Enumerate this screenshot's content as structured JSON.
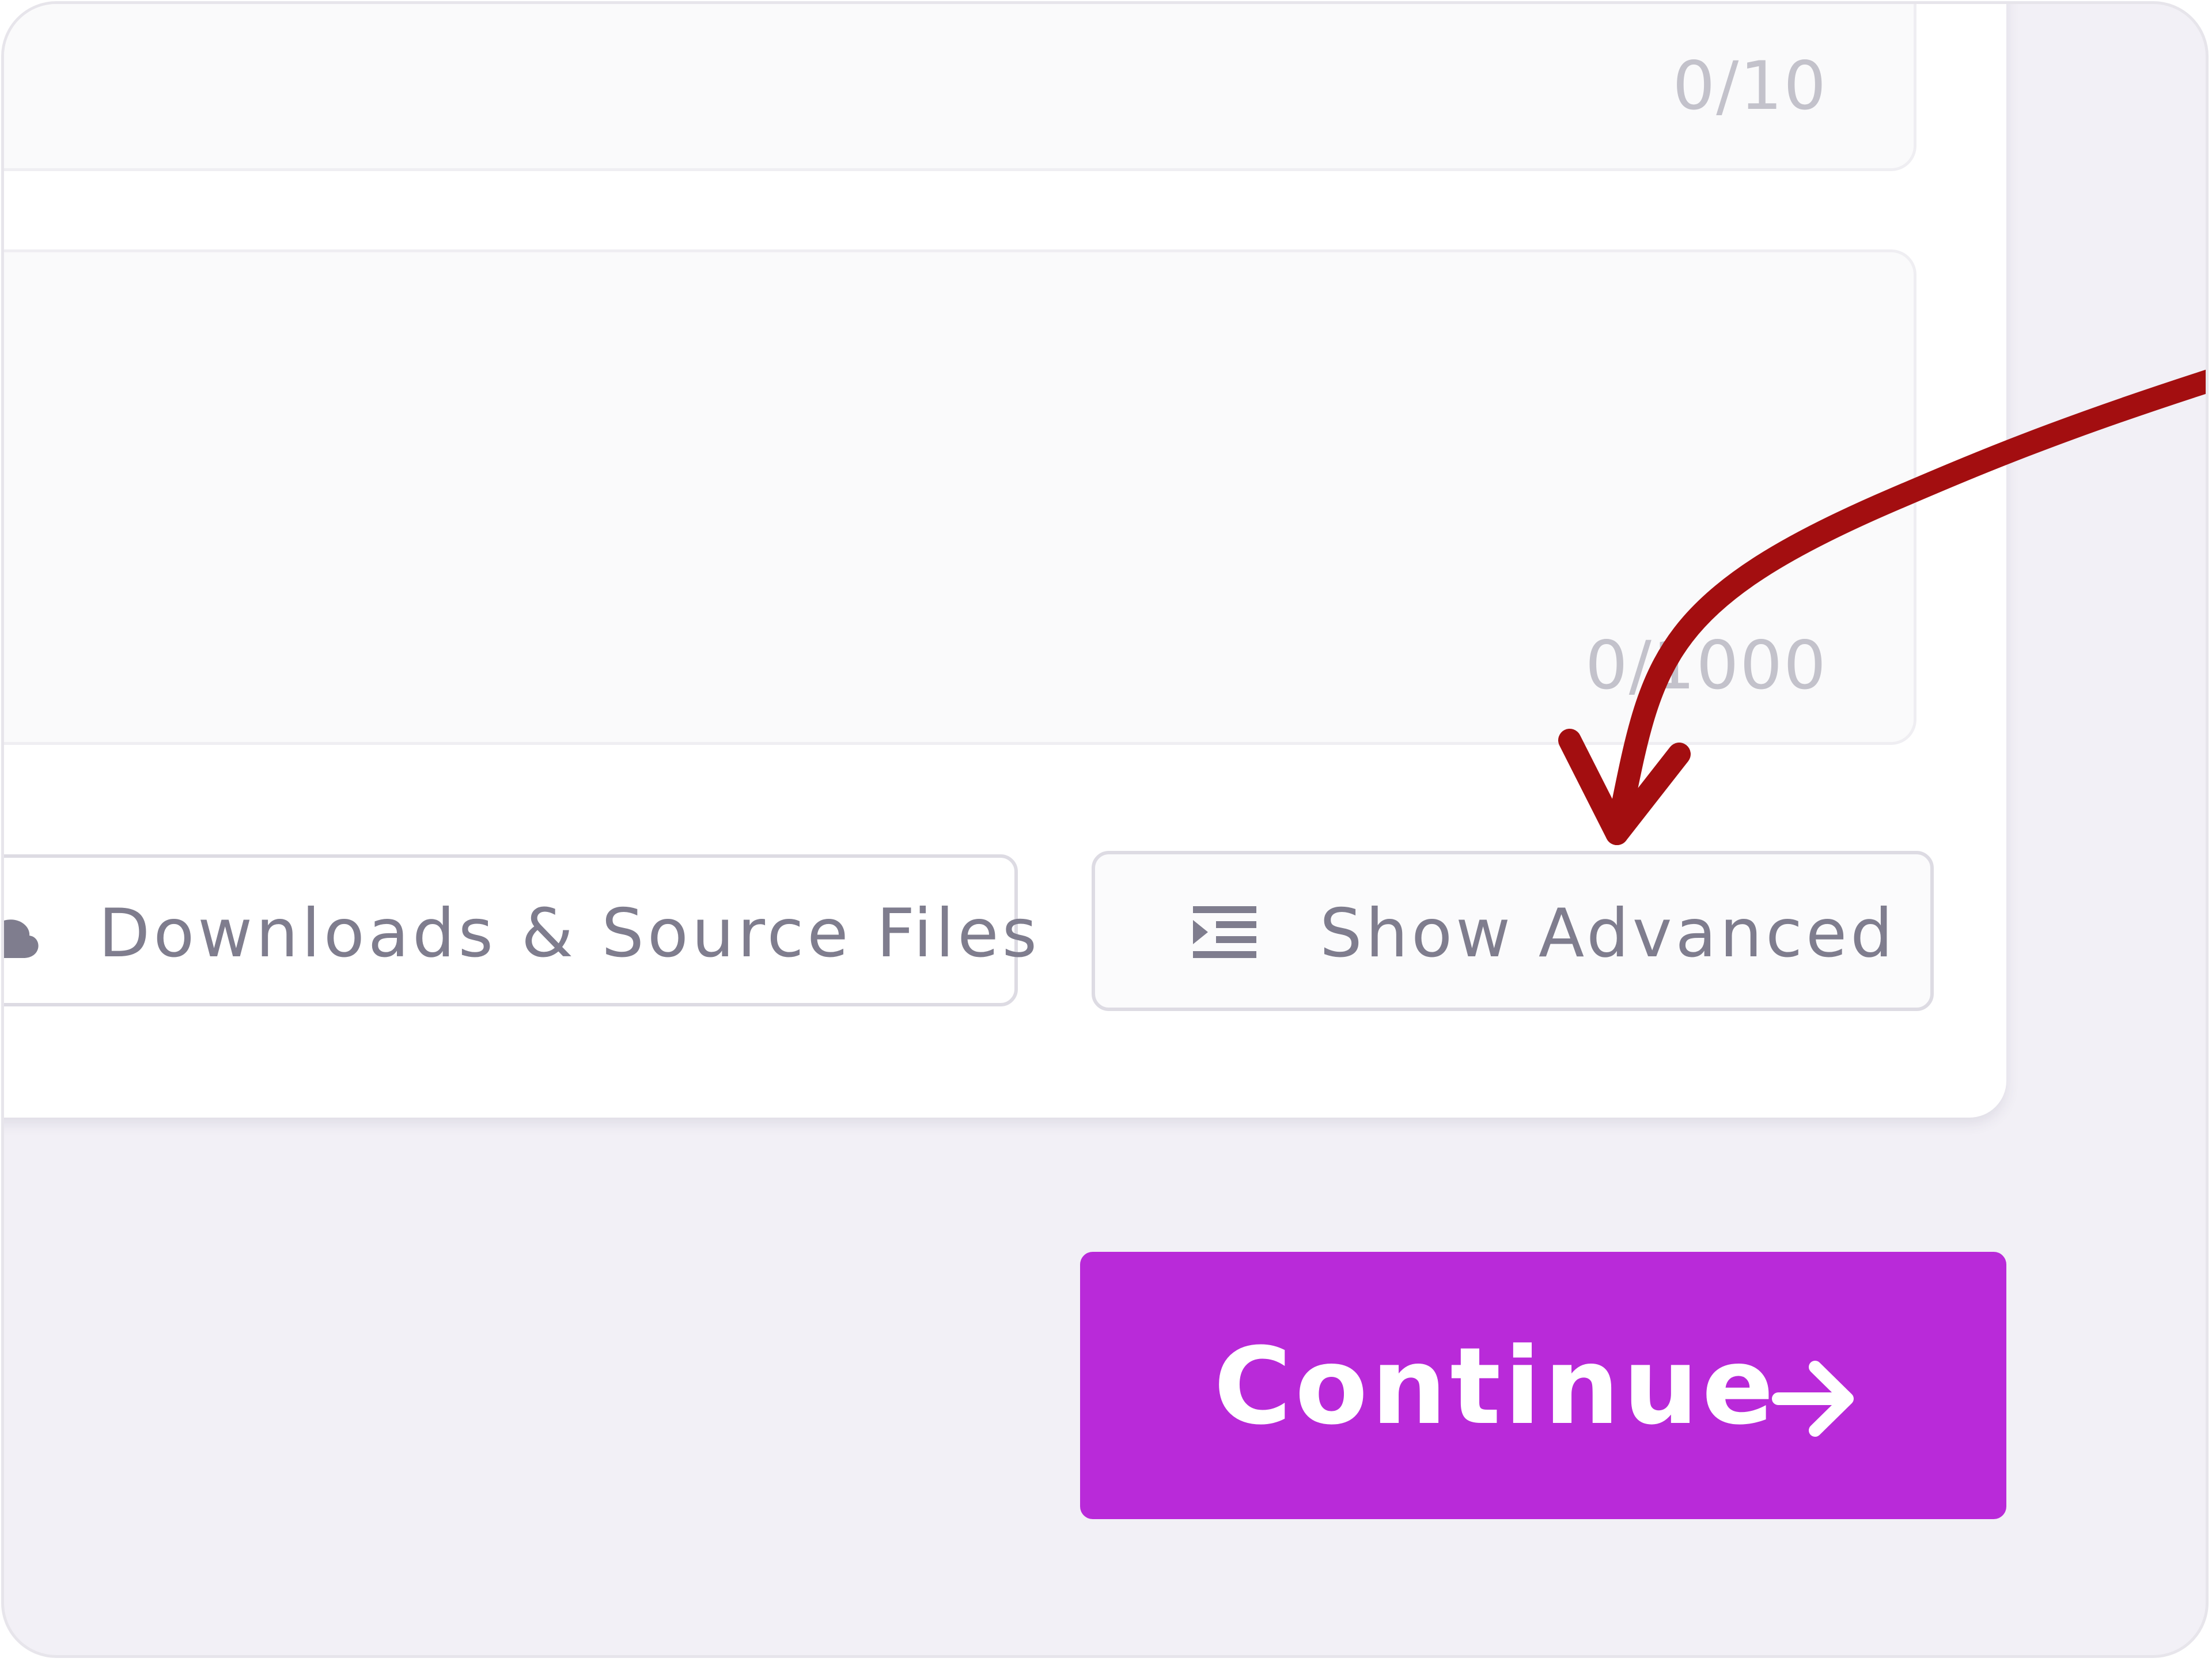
{
  "form": {
    "title_field": {
      "counter": "0/10"
    },
    "description_field": {
      "counter": "0/1000"
    }
  },
  "actions": {
    "downloads_label": "Downloads & Source Files",
    "downloads_icon": "cloud-download-icon",
    "advanced_label": "Show Advanced",
    "advanced_icon": "list-indent-icon",
    "continue_label": "Continue",
    "continue_icon": "arrow-right-icon"
  },
  "colors": {
    "primary": "#b92ad9",
    "annotation_arrow": "#a30e10",
    "background": "#f2f0f6"
  }
}
